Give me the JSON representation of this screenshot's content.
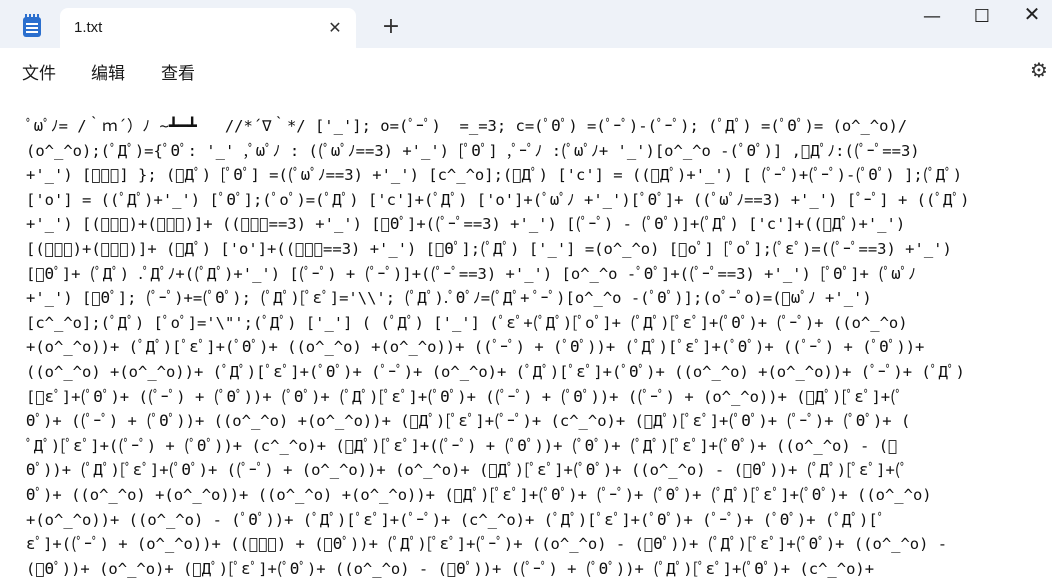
{
  "window": {
    "tab_title": "1.txt",
    "close_tab_glyph": "✕",
    "new_tab_glyph": "+",
    "minimize_glyph": "—",
    "maximize_glyph": "☐",
    "close_glyph": "✕"
  },
  "menu": {
    "file": "文件",
    "edit": "编辑",
    "view": "查看",
    "settings_icon": "⚙"
  },
  "editor": {
    "lines": [
      "ﾟωﾟﾉ= /｀ｍ´）ﾉ ~┻━┻   //*´∇｀*/ ['_']; o=(ﾟｰﾟ)  =_=3; c=(ﾟΘﾟ) =(ﾟｰﾟ)-(ﾟｰﾟ); (ﾟДﾟ) =(ﾟΘﾟ)= (o^_^o)/",
      "(o^_^o);(ﾟДﾟ)={ﾟΘﾟ: '_' ,ﾟωﾟﾉ : ((ﾟωﾟﾉ==3) +'_') [ﾟΘﾟ] ,ﾟｰﾟﾉ :(ﾟωﾟﾉ+ '_')[o^_^o -(ﾟΘﾟ)] ,ﾟДﾟﾉ:((ﾟｰﾟ==3)",
      "+'_') [ﾟｰﾟ] }; (ﾟДﾟ) [ﾟΘﾟ] =((ﾟωﾟﾉ==3) +'_') [c^_^o];(ﾟДﾟ) ['c'] = ((ﾟДﾟ)+'_') [ (ﾟｰﾟ)+(ﾟｰﾟ)-(ﾟΘﾟ) ];(ﾟДﾟ)",
      "['o'] = ((ﾟДﾟ)+'_') [ﾟΘﾟ];(ﾟoﾟ)=(ﾟДﾟ) ['c']+(ﾟДﾟ) ['o']+(ﾟωﾟﾉ +'_')[ﾟΘﾟ]+ ((ﾟωﾟﾉ==3) +'_') [ﾟｰﾟ] + ((ﾟДﾟ)",
      "+'_') [(ﾟｰﾟ)+(ﾟｰﾟ)]+ ((ﾟｰﾟ==3) +'_') [ﾟΘﾟ]+((ﾟｰﾟ==3) +'_') [(ﾟｰﾟ) - (ﾟΘﾟ)]+(ﾟДﾟ) ['c']+((ﾟДﾟ)+'_')",
      "[(ﾟｰﾟ)+(ﾟｰﾟ)]+ (ﾟДﾟ) ['o']+((ﾟｰﾟ==3) +'_') [ﾟΘﾟ];(ﾟДﾟ) ['_'] =(o^_^o) [ﾟoﾟ] [ﾟoﾟ];(ﾟεﾟ)=((ﾟｰﾟ==3) +'_')",
      "[ﾟΘﾟ]+ (ﾟДﾟ) .ﾟДﾟﾉ+((ﾟДﾟ)+'_') [(ﾟｰﾟ) + (ﾟｰﾟ)]+((ﾟｰﾟ==3) +'_') [o^_^o -ﾟΘﾟ]+((ﾟｰﾟ==3) +'_') [ﾟΘﾟ]+ (ﾟωﾟﾉ",
      "+'_') [ﾟΘﾟ]; (ﾟｰﾟ)+=(ﾟΘﾟ); (ﾟДﾟ)[ﾟεﾟ]='\\\\'; (ﾟДﾟ).ﾟΘﾟﾉ=(ﾟДﾟ+ ﾟｰﾟ)[o^_^o -(ﾟΘﾟ)];(oﾟｰﾟo)=(ﾟωﾟﾉ +'_')",
      "[c^_^o];(ﾟДﾟ) [ﾟoﾟ]='\\\"';(ﾟДﾟ) ['_'] ( (ﾟДﾟ) ['_'] (ﾟεﾟ+(ﾟДﾟ)[ﾟoﾟ]+ (ﾟДﾟ)[ﾟεﾟ]+(ﾟΘﾟ)+ (ﾟｰﾟ)+ ((o^_^o)",
      "+(o^_^o))+ (ﾟДﾟ)[ﾟεﾟ]+(ﾟΘﾟ)+ ((o^_^o) +(o^_^o))+ ((ﾟｰﾟ) + (ﾟΘﾟ))+ (ﾟДﾟ)[ﾟεﾟ]+(ﾟΘﾟ)+ ((ﾟｰﾟ) + (ﾟΘﾟ))+",
      "((o^_^o) +(o^_^o))+ (ﾟДﾟ)[ﾟεﾟ]+(ﾟΘﾟ)+ (ﾟｰﾟ)+ (o^_^o)+ (ﾟДﾟ)[ﾟεﾟ]+(ﾟΘﾟ)+ ((o^_^o) +(o^_^o))+ (ﾟｰﾟ)+ (ﾟДﾟ)",
      "[ﾟεﾟ]+(ﾟΘﾟ)+ ((ﾟｰﾟ) + (ﾟΘﾟ))+ (ﾟΘﾟ)+ (ﾟДﾟ)[ﾟεﾟ]+(ﾟΘﾟ)+ ((ﾟｰﾟ) + (ﾟΘﾟ))+ ((ﾟｰﾟ) + (o^_^o))+ (ﾟДﾟ)[ﾟεﾟ]+(ﾟ",
      "Θﾟ)+ ((ﾟｰﾟ) + (ﾟΘﾟ))+ ((o^_^o) +(o^_^o))+ (ﾟДﾟ)[ﾟεﾟ]+(ﾟｰﾟ)+ (c^_^o)+ (ﾟДﾟ)[ﾟεﾟ]+(ﾟΘﾟ)+ (ﾟｰﾟ)+ (ﾟΘﾟ)+ (",
      "ﾟДﾟ)[ﾟεﾟ]+((ﾟｰﾟ) + (ﾟΘﾟ))+ (c^_^o)+ (ﾟДﾟ)[ﾟεﾟ]+((ﾟｰﾟ) + (ﾟΘﾟ))+ (ﾟΘﾟ)+ (ﾟДﾟ)[ﾟεﾟ]+(ﾟΘﾟ)+ ((o^_^o) - (ﾟ",
      "Θﾟ))+ (ﾟДﾟ)[ﾟεﾟ]+(ﾟΘﾟ)+ ((ﾟｰﾟ) + (o^_^o))+ (o^_^o)+ (ﾟДﾟ)[ﾟεﾟ]+(ﾟΘﾟ)+ ((o^_^o) - (ﾟΘﾟ))+ (ﾟДﾟ)[ﾟεﾟ]+(ﾟ",
      "Θﾟ)+ ((o^_^o) +(o^_^o))+ ((o^_^o) +(o^_^o))+ (ﾟДﾟ)[ﾟεﾟ]+(ﾟΘﾟ)+ (ﾟｰﾟ)+ (ﾟΘﾟ)+ (ﾟДﾟ)[ﾟεﾟ]+(ﾟΘﾟ)+ ((o^_^o)",
      "+(o^_^o))+ ((o^_^o) - (ﾟΘﾟ))+ (ﾟДﾟ)[ﾟεﾟ]+(ﾟｰﾟ)+ (c^_^o)+ (ﾟДﾟ)[ﾟεﾟ]+(ﾟΘﾟ)+ (ﾟｰﾟ)+ (ﾟΘﾟ)+ (ﾟДﾟ)[ﾟ",
      "εﾟ]+((ﾟｰﾟ) + (o^_^o))+ ((ﾟｰﾟ) + (ﾟΘﾟ))+ (ﾟДﾟ)[ﾟεﾟ]+(ﾟｰﾟ)+ ((o^_^o) - (ﾟΘﾟ))+ (ﾟДﾟ)[ﾟεﾟ]+(ﾟΘﾟ)+ ((o^_^o) -",
      "(ﾟΘﾟ))+ (o^_^o)+ (ﾟДﾟ)[ﾟεﾟ]+(ﾟΘﾟ)+ ((o^_^o) - (ﾟΘﾟ))+ ((ﾟｰﾟ) + (ﾟΘﾟ))+ (ﾟДﾟ)[ﾟεﾟ]+(ﾟΘﾟ)+ (c^_^o)+"
    ]
  }
}
